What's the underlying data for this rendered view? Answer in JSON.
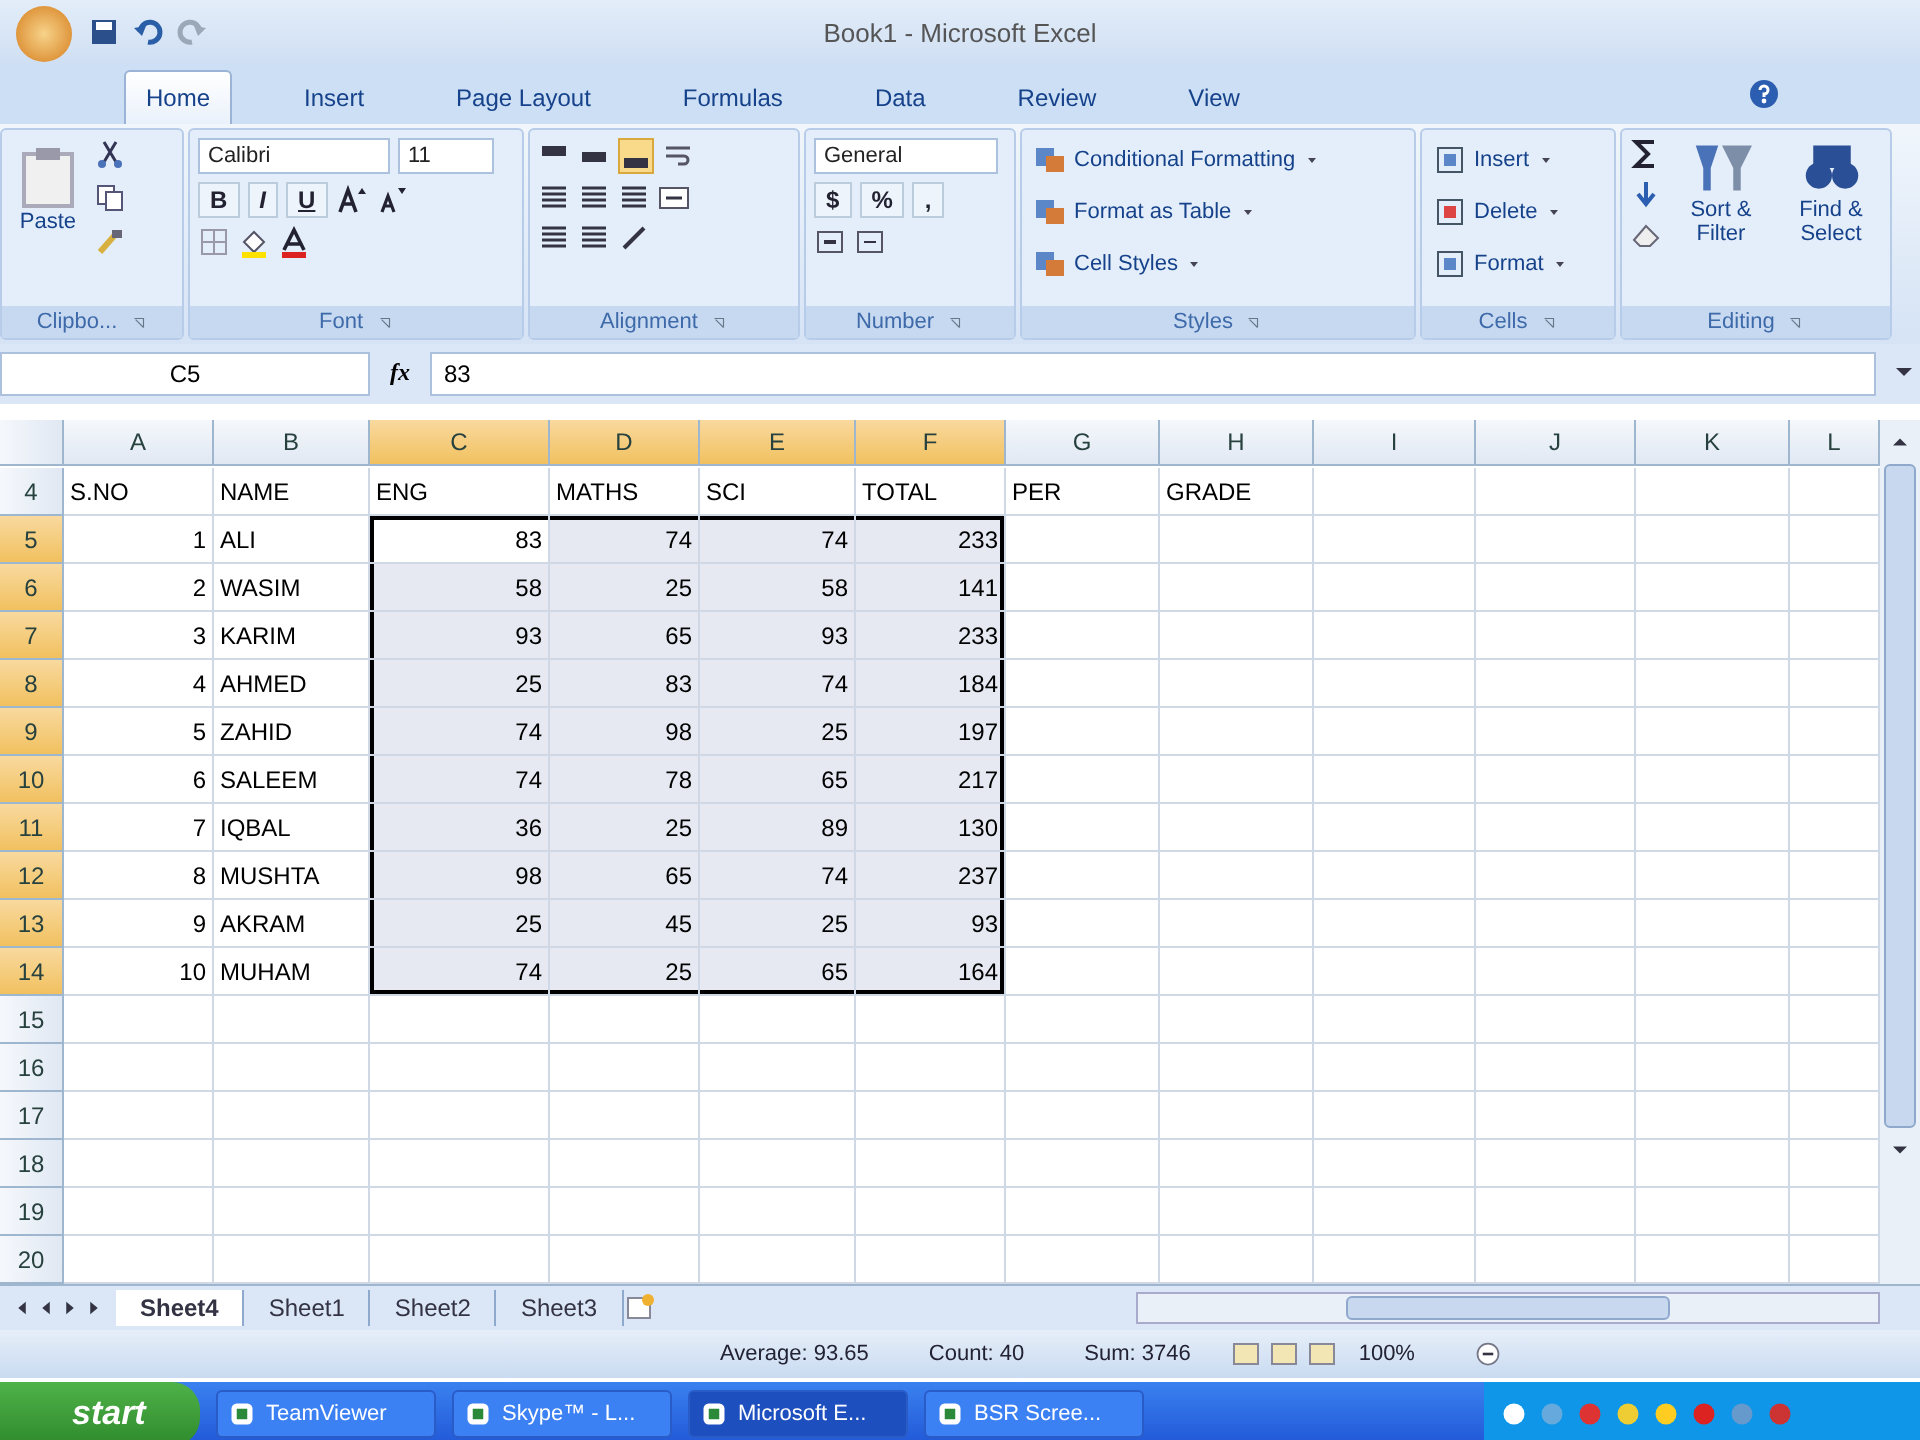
{
  "window": {
    "title": "Book1 - Microsoft Excel"
  },
  "ribbon_tabs": [
    {
      "label": "Home",
      "selected": true
    },
    {
      "label": "Insert",
      "selected": false
    },
    {
      "label": "Page Layout",
      "selected": false
    },
    {
      "label": "Formulas",
      "selected": false
    },
    {
      "label": "Data",
      "selected": false
    },
    {
      "label": "Review",
      "selected": false
    },
    {
      "label": "View",
      "selected": false
    }
  ],
  "ribbon": {
    "clipboard": {
      "paste": "Paste",
      "label": "Clipbo..."
    },
    "font": {
      "name": "Calibri",
      "size": "11",
      "styles": [
        "B",
        "I",
        "U"
      ],
      "label": "Font"
    },
    "alignment": {
      "label": "Alignment"
    },
    "number": {
      "format": "General",
      "symbols": [
        "$",
        "%",
        ","
      ],
      "label": "Number"
    },
    "styles": {
      "items": [
        "Conditional Formatting",
        "Format as Table",
        "Cell Styles"
      ],
      "label": "Styles"
    },
    "cells": {
      "items": [
        "Insert",
        "Delete",
        "Format"
      ],
      "label": "Cells"
    },
    "editing": {
      "items": [
        "Sort & Filter",
        "Find & Select"
      ],
      "label": "Editing"
    }
  },
  "formula_bar": {
    "name_box": "C5",
    "fx": "fx",
    "value": "83"
  },
  "grid": {
    "columns": [
      {
        "label": "A",
        "selected": false
      },
      {
        "label": "B",
        "selected": false
      },
      {
        "label": "C",
        "selected": true
      },
      {
        "label": "D",
        "selected": true
      },
      {
        "label": "E",
        "selected": true
      },
      {
        "label": "F",
        "selected": true
      },
      {
        "label": "G",
        "selected": false
      },
      {
        "label": "H",
        "selected": false
      },
      {
        "label": "I",
        "selected": false
      },
      {
        "label": "J",
        "selected": false
      },
      {
        "label": "K",
        "selected": false
      },
      {
        "label": "L",
        "selected": false
      }
    ],
    "rows": [
      {
        "header": "4",
        "selected": false,
        "cells": [
          "S.NO",
          "NAME",
          "ENG",
          "MATHS",
          "SCI",
          "TOTAL",
          "PER",
          "GRADE"
        ]
      },
      {
        "header": "5",
        "selected": true,
        "cells": [
          "1",
          "ALI",
          "83",
          "74",
          "74",
          "233"
        ]
      },
      {
        "header": "6",
        "selected": true,
        "cells": [
          "2",
          "WASIM",
          "58",
          "25",
          "58",
          "141"
        ]
      },
      {
        "header": "7",
        "selected": true,
        "cells": [
          "3",
          "KARIM",
          "93",
          "65",
          "93",
          "233"
        ]
      },
      {
        "header": "8",
        "selected": true,
        "cells": [
          "4",
          "AHMED",
          "25",
          "83",
          "74",
          "184"
        ]
      },
      {
        "header": "9",
        "selected": true,
        "cells": [
          "5",
          "ZAHID",
          "74",
          "98",
          "25",
          "197"
        ]
      },
      {
        "header": "10",
        "selected": true,
        "cells": [
          "6",
          "SALEEM",
          "74",
          "78",
          "65",
          "217"
        ]
      },
      {
        "header": "11",
        "selected": true,
        "cells": [
          "7",
          "IQBAL",
          "36",
          "25",
          "89",
          "130"
        ]
      },
      {
        "header": "12",
        "selected": true,
        "cells": [
          "8",
          "MUSHTA",
          "98",
          "65",
          "74",
          "237"
        ]
      },
      {
        "header": "13",
        "selected": true,
        "cells": [
          "9",
          "AKRAM",
          "25",
          "45",
          "25",
          "93"
        ]
      },
      {
        "header": "14",
        "selected": true,
        "cells": [
          "10",
          "MUHAM",
          "74",
          "25",
          "65",
          "164"
        ]
      },
      {
        "header": "15",
        "selected": false,
        "cells": []
      },
      {
        "header": "16",
        "selected": false,
        "cells": []
      },
      {
        "header": "17",
        "selected": false,
        "cells": []
      },
      {
        "header": "18",
        "selected": false,
        "cells": []
      },
      {
        "header": "19",
        "selected": false,
        "cells": []
      },
      {
        "header": "20",
        "selected": false,
        "cells": []
      }
    ]
  },
  "sheet_tabs": [
    {
      "label": "Sheet4",
      "selected": true
    },
    {
      "label": "Sheet1",
      "selected": false
    },
    {
      "label": "Sheet2",
      "selected": false
    },
    {
      "label": "Sheet3",
      "selected": false
    }
  ],
  "status_bar": {
    "average": "Average: 93.65",
    "count": "Count: 40",
    "sum": "Sum: 3746",
    "zoom": "100%"
  },
  "taskbar": {
    "start": "start",
    "items": [
      {
        "label": "TeamViewer",
        "selected": false
      },
      {
        "label": "Skype™ - L...",
        "selected": false
      },
      {
        "label": "Microsoft E...",
        "selected": true
      },
      {
        "label": "BSR Scree...",
        "selected": false
      }
    ]
  }
}
